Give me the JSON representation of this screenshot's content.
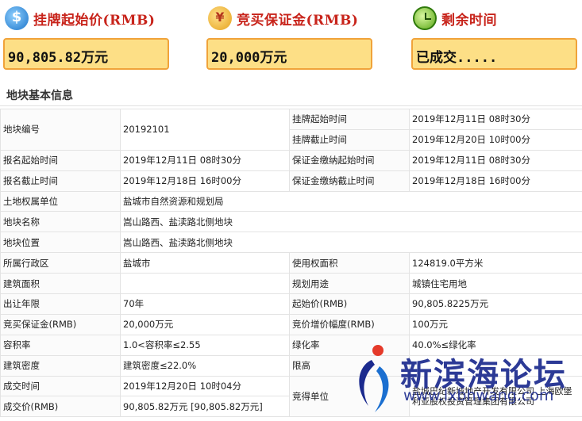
{
  "summary": {
    "start_price": {
      "label": "挂牌起始价(RMB)",
      "value": "90,805.82万元",
      "icon": "dollar-coin-icon",
      "icon_color": "#1a73c8"
    },
    "deposit": {
      "label": "竞买保证金(RMB)",
      "value": "20,000万元",
      "icon": "coins-icon",
      "icon_color": "#e5a11c"
    },
    "remaining": {
      "label": "剩余时间",
      "value": "已成交.....",
      "icon": "clock-icon",
      "icon_color": "#5aa817"
    }
  },
  "section_title": "地块基本信息",
  "table": {
    "plot_no_label": "地块编号",
    "plot_no": "20192101",
    "listing_start_label": "挂牌起始时间",
    "listing_start": "2019年12月11日 08时30分",
    "listing_end_label": "挂牌截止时间",
    "listing_end": "2019年12月20日 10时00分",
    "signup_start_label": "报名起始时间",
    "signup_start": "2019年12月11日 08时30分",
    "deposit_start_label": "保证金缴纳起始时间",
    "deposit_start": "2019年12月11日 08时30分",
    "signup_end_label": "报名截止时间",
    "signup_end": "2019年12月18日 16时00分",
    "deposit_end_label": "保证金缴纳截止时间",
    "deposit_end": "2019年12月18日 16时00分",
    "owner_label": "土地权属单位",
    "owner": "盐城市自然资源和规划局",
    "name_label": "地块名称",
    "name": "嵩山路西、盐渎路北侧地块",
    "location_label": "地块位置",
    "location": "嵩山路西、盐渎路北侧地块",
    "district_label": "所属行政区",
    "district": "盐城市",
    "area_label": "使用权面积",
    "area": "124819.0平方米",
    "building_area_label": "建筑面积",
    "building_area": "",
    "use_label": "规划用途",
    "use": "城镇住宅用地",
    "term_label": "出让年限",
    "term": "70年",
    "start_price_label": "起始价(RMB)",
    "start_price": "90,805.8225万元",
    "deposit_label": "竞买保证金(RMB)",
    "deposit": "20,000万元",
    "increment_label": "竞价增价幅度(RMB)",
    "increment": "100万元",
    "far_label": "容积率",
    "far": "1.0<容积率≤2.55",
    "green_label": "绿化率",
    "green": "40.0%≤绿化率",
    "density_label": "建筑密度",
    "density": "建筑密度≤22.0%",
    "height_label": "限高",
    "height": "",
    "deal_time_label": "成交时间",
    "deal_time": "2019年12月20日 10时04分",
    "deal_price_label": "成交价(RMB)",
    "deal_price": "90,805.82万元 [90,805.82万元]",
    "winner_label": "竞得单位",
    "winner": "盐城巴纪新城地产开发有限公司 上海欧堡利亚股权投资管理集团有限公司"
  },
  "watermark": {
    "name": "新滨海论坛",
    "url": "www.lxbhwang.com",
    "color": "#1b2a8e",
    "accent": "#e53a2a"
  }
}
